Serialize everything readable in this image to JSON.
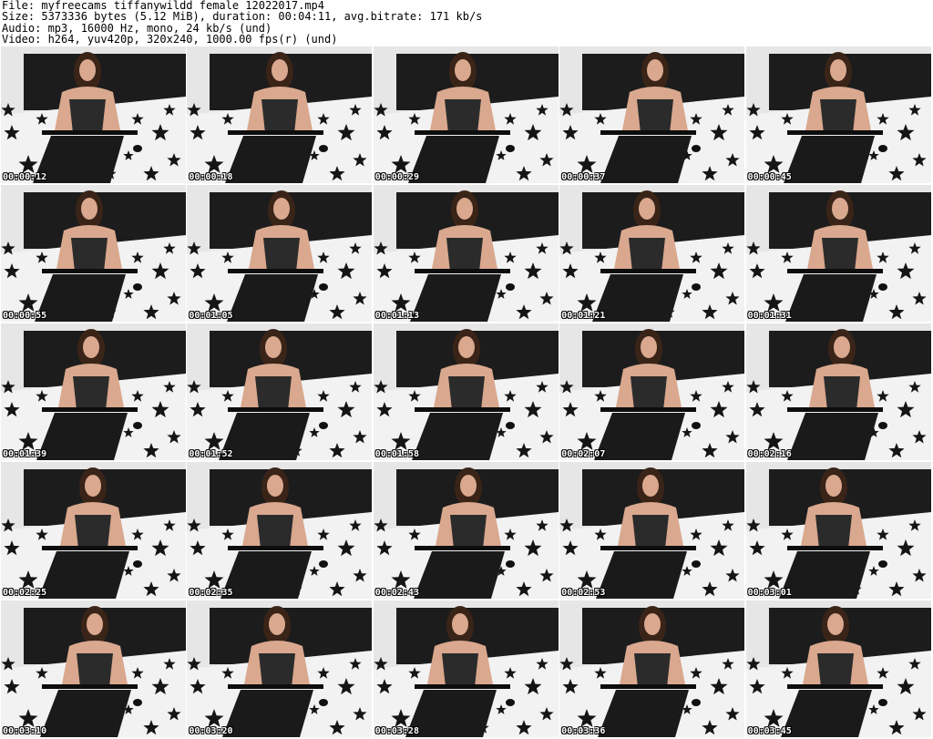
{
  "header": {
    "lines": [
      "File: myfreecams_tiffanywildd_female_12022017.mp4",
      "Size: 5373336 bytes (5.12 MiB), duration: 00:04:11, avg.bitrate: 171 kb/s",
      "Audio: mp3, 16000 Hz, mono, 24 kb/s (und)",
      "Video: h264, yuv420p, 320x240, 1000.00 fps(r) (und)"
    ]
  },
  "thumbnails": [
    {
      "timestamp": "00:00:12"
    },
    {
      "timestamp": "00:00:18"
    },
    {
      "timestamp": "00:00:29"
    },
    {
      "timestamp": "00:00:37"
    },
    {
      "timestamp": "00:00:45"
    },
    {
      "timestamp": "00:00:55"
    },
    {
      "timestamp": "00:01:05"
    },
    {
      "timestamp": "00:01:13"
    },
    {
      "timestamp": "00:01:21"
    },
    {
      "timestamp": "00:01:31"
    },
    {
      "timestamp": "00:01:39"
    },
    {
      "timestamp": "00:01:52"
    },
    {
      "timestamp": "00:01:58"
    },
    {
      "timestamp": "00:02:07"
    },
    {
      "timestamp": "00:02:16"
    },
    {
      "timestamp": "00:02:25"
    },
    {
      "timestamp": "00:02:35"
    },
    {
      "timestamp": "00:02:43"
    },
    {
      "timestamp": "00:02:53"
    },
    {
      "timestamp": "00:03:01"
    },
    {
      "timestamp": "00:03:10"
    },
    {
      "timestamp": "00:03:20"
    },
    {
      "timestamp": "00:03:28"
    },
    {
      "timestamp": "00:03:36"
    },
    {
      "timestamp": "00:03:45"
    }
  ],
  "colors": {
    "background": "#ffffff",
    "header_text": "#000000",
    "headboard": "#1c1c1c",
    "wall": "#e6e6e6",
    "bedding": "#f2f2f2",
    "stars": "#151515",
    "skin": "#d9a88e",
    "hair": "#3a2418",
    "lingerie": "#2b2b2b",
    "stockings": "#1a1a1a",
    "timestamp_text": "#ffffff"
  }
}
